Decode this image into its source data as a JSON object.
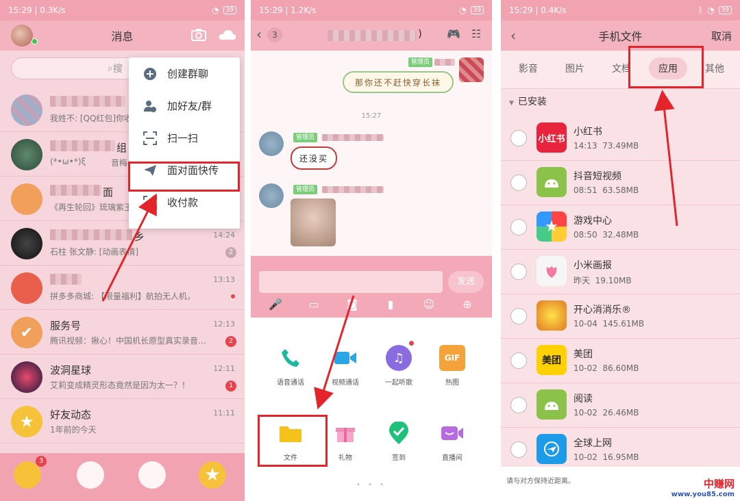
{
  "status": {
    "time": "15:29",
    "speed_p1": "0.3K/s",
    "speed_p2": "1.2K/s",
    "speed_p3": "0.4K/s",
    "battery": "39"
  },
  "panel1": {
    "title": "消息",
    "search_placeholder": "搜",
    "menu": [
      {
        "label": "创建群聊",
        "icon": "plus-circle-icon"
      },
      {
        "label": "加好友/群",
        "icon": "add-friend-icon"
      },
      {
        "label": "扫一扫",
        "icon": "scan-icon"
      },
      {
        "label": "面对面快传",
        "icon": "send-plane-icon"
      },
      {
        "label": "收付款",
        "icon": "payment-icon"
      }
    ],
    "chats": [
      {
        "name": "",
        "msg": "我姓不: [QQ红包]你收",
        "time": "",
        "badge": ""
      },
      {
        "name": "组",
        "msg": "(*•ω•*)ξ",
        "msg2": "音梅:",
        "time": "",
        "badge": ""
      },
      {
        "name": "面",
        "msg": "《再生轮回》琉璃紫玉",
        "time": "",
        "badge": ""
      },
      {
        "name": "乡",
        "msg": "石柱 张文静: [动画表情]",
        "time": "14:24",
        "badge": "2"
      },
      {
        "name": "",
        "msg": "拼多多商城: 【限量福利】航拍无人机，",
        "time": "13:13",
        "badge": ""
      },
      {
        "name": "服务号",
        "msg": "腾讯视频：揪心！中国机长原型真实录音…",
        "time": "12:13",
        "badge": "2"
      },
      {
        "name": "波洞星球",
        "msg": "艾莉变成精灵形态竟然是因为太一？！",
        "time": "12:11",
        "badge": "1"
      },
      {
        "name": "好友动态",
        "msg": "1年前的今天",
        "time": "11:11",
        "badge": ""
      }
    ],
    "tab_badge": "3"
  },
  "panel2": {
    "back_count": "3",
    "admin_tag": "管理员",
    "bubble1": "那你还不赶快穿长袜",
    "timestamp": "15:27",
    "bubble2": "还没买",
    "send_label": "发送",
    "grid_items": [
      {
        "label": "语音通话",
        "icon": "phone-icon"
      },
      {
        "label": "视频通话",
        "icon": "video-icon"
      },
      {
        "label": "一起听歌",
        "icon": "headphones-icon"
      },
      {
        "label": "热图",
        "icon": "gif-icon"
      },
      {
        "label": "文件",
        "icon": "folder-icon"
      },
      {
        "label": "礼物",
        "icon": "gift-icon"
      },
      {
        "label": "签到",
        "icon": "checkin-icon"
      },
      {
        "label": "直播间",
        "icon": "live-icon"
      }
    ],
    "pager": "• • •"
  },
  "panel3": {
    "title": "手机文件",
    "cancel": "取消",
    "tabs": [
      "影音",
      "图片",
      "文档",
      "应用",
      "其他"
    ],
    "active_tab": "应用",
    "section": "已安装",
    "apps": [
      {
        "name": "小红书",
        "time": "14:13",
        "size": "73.49MB",
        "icon_text": "小红书",
        "color": "#e8243c"
      },
      {
        "name": "抖音短视频",
        "time": "08:51",
        "size": "63.58MB",
        "icon_text": "",
        "color": "#8bc34a"
      },
      {
        "name": "游戏中心",
        "time": "08:50",
        "size": "32.48MB",
        "icon_text": "★",
        "color": "#3aa0e8"
      },
      {
        "name": "小米画报",
        "time": "昨天",
        "size": "19.10MB",
        "icon_text": "",
        "color": "#f6f6f6"
      },
      {
        "name": "开心消消乐®",
        "time": "10-04",
        "size": "145.61MB",
        "icon_text": "",
        "color": "#f0b020"
      },
      {
        "name": "美团",
        "time": "10-02",
        "size": "86.60MB",
        "icon_text": "美团",
        "color": "#ffd100"
      },
      {
        "name": "阅读",
        "time": "10-02",
        "size": "26.46MB",
        "icon_text": "",
        "color": "#8bc34a"
      },
      {
        "name": "全球上网",
        "time": "10-02",
        "size": "16.95MB",
        "icon_text": "",
        "color": "#1e9be8"
      }
    ],
    "footnote": "请与对方保持近距离。",
    "watermark_top": "中赚网",
    "watermark_bottom": "www.you85.com"
  },
  "colors": {
    "accent": "#f3b4c0",
    "highlight": "#e3242b",
    "badge": "#e8434c"
  }
}
